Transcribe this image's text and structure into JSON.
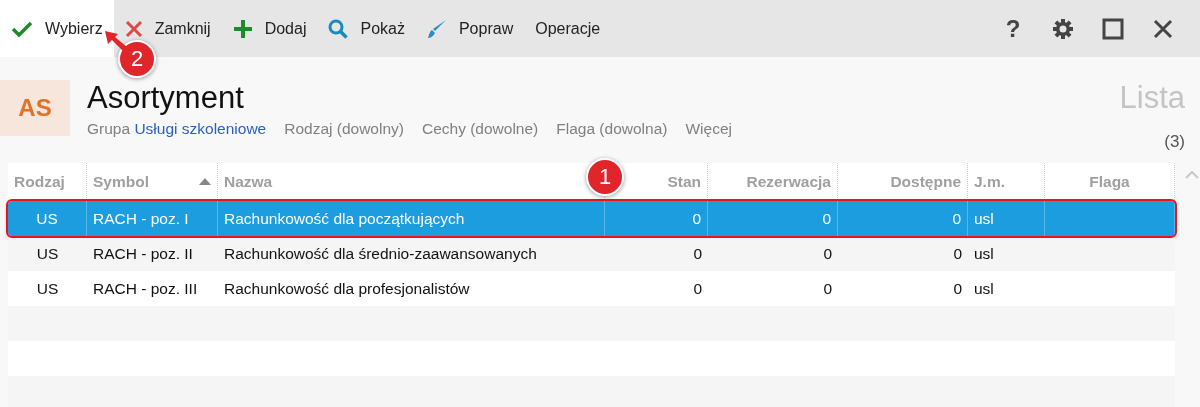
{
  "toolbar": {
    "buttons": [
      {
        "kind": "check",
        "label": "Wybierz",
        "selected": true
      },
      {
        "kind": "close",
        "label": "Zamknij",
        "selected": false
      },
      {
        "kind": "plus",
        "label": "Dodaj",
        "selected": false
      },
      {
        "kind": "search",
        "label": "Pokaż",
        "selected": false
      },
      {
        "kind": "brush",
        "label": "Popraw",
        "selected": false
      },
      {
        "kind": "none",
        "label": "Operacje",
        "selected": false
      }
    ],
    "help": "?"
  },
  "header": {
    "badge": "AS",
    "title": "Asortyment",
    "view": "Lista",
    "count": "(3)",
    "filters": [
      {
        "label": "Grupa",
        "value": "Usługi szkoleniowe"
      },
      {
        "label": "Rodzaj (dowolny)"
      },
      {
        "label": "Cechy (dowolne)"
      },
      {
        "label": "Flaga (dowolna)"
      },
      {
        "label": "Więcej"
      }
    ]
  },
  "table": {
    "columns": [
      {
        "label": "Rodzaj",
        "sorted": false
      },
      {
        "label": "Symbol",
        "sorted": true
      },
      {
        "label": "Nazwa",
        "sorted": false
      },
      {
        "label": "Stan",
        "sorted": false
      },
      {
        "label": "Rezerwacja",
        "sorted": false
      },
      {
        "label": "Dostępne",
        "sorted": false
      },
      {
        "label": "J.m.",
        "sorted": false
      },
      {
        "label": "Flaga",
        "sorted": false
      }
    ],
    "rows": [
      {
        "selected": true,
        "cells": [
          "US",
          "RACH - poz. I",
          "Rachunkowość dla początkujących",
          "0",
          "0",
          "0",
          "usl"
        ]
      },
      {
        "selected": false,
        "cells": [
          "US",
          "RACH - poz. II",
          "Rachunkowość dla średnio-zaawansowanych",
          "0",
          "0",
          "0",
          "usl"
        ]
      },
      {
        "selected": false,
        "cells": [
          "US",
          "RACH - poz. III",
          "Rachunkowość dla profesjonalistów",
          "0",
          "0",
          "0",
          "usl"
        ]
      }
    ]
  },
  "callouts": [
    {
      "label": "1"
    },
    {
      "label": "2"
    }
  ]
}
